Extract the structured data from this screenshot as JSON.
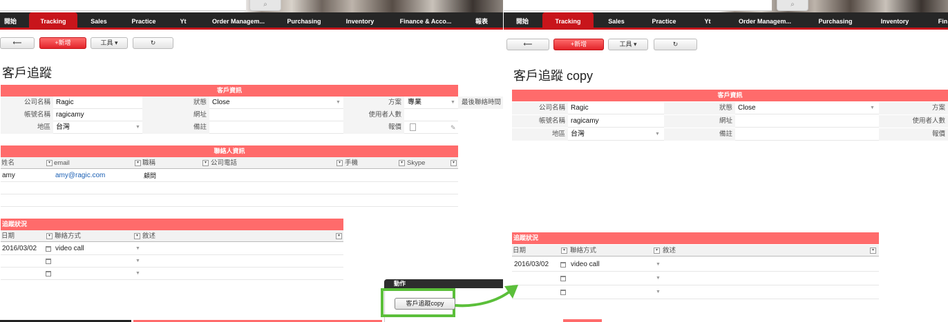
{
  "nav": {
    "left": [
      "開始",
      "Tracking",
      "Sales",
      "Practice",
      "Yt",
      "Order Managem...",
      "Purchasing",
      "Inventory",
      "Finance & Acco...",
      "報表"
    ],
    "right": [
      "開始",
      "Tracking",
      "Sales",
      "Practice",
      "Yt",
      "Order Managem...",
      "Purchasing",
      "Inventory",
      "Fin"
    ],
    "active": "Tracking"
  },
  "toolbar": {
    "back": "⟵",
    "new": "+新增",
    "tools": "工具 ▾",
    "refresh": "↻"
  },
  "icons": {
    "search": "search-icon",
    "back": "arrow-left-icon",
    "refresh": "refresh-icon",
    "calendar": "calendar-icon",
    "attach": "paperclip-icon",
    "file": "file-icon"
  },
  "colors": {
    "accent": "#ff6b6b",
    "nav_active": "#c8151b",
    "link": "#1a5fb4",
    "highlight": "#5bbf3a"
  },
  "left": {
    "title": "客戶追蹤",
    "customer_section": "客戶資訊",
    "fields": {
      "company_label": "公司名稱",
      "company": "Ragic",
      "status_label": "狀態",
      "status": "Close",
      "plan_label": "方案",
      "plan": "專業",
      "last_contact_label": "最後聯絡時間",
      "account_label": "帳號名稱",
      "account": "ragicamy",
      "website_label": "網址",
      "users_label": "使用者人數",
      "region_label": "地區",
      "region": "台灣",
      "note_label": "備註",
      "quote_label": "報價"
    },
    "contacts_section": "聯絡人資訊",
    "contacts_columns": [
      "姓名",
      "email",
      "職稱",
      "公司電話",
      "手機",
      "Skype"
    ],
    "contacts": [
      {
        "name": "amy",
        "email": "amy@ragic.com",
        "title": "顧問"
      }
    ],
    "tracking_section": "追蹤狀況",
    "tracking_columns": [
      "日期",
      "聯絡方式",
      "敘述"
    ],
    "tracking": [
      {
        "date": "2016/03/02",
        "method": "video call"
      }
    ],
    "action_title": "動作",
    "action_button": "客戶追蹤copy"
  },
  "right": {
    "title": "客戶追蹤 copy",
    "customer_section": "客戶資訊",
    "fields": {
      "company_label": "公司名稱",
      "company": "Ragic",
      "status_label": "狀態",
      "status": "Close",
      "plan_label": "方案",
      "account_label": "帳號名稱",
      "account": "ragicamy",
      "website_label": "網址",
      "users_label": "使用者人數",
      "region_label": "地區",
      "region": "台灣",
      "note_label": "備註",
      "quote_label": "報價"
    },
    "tracking_section": "追蹤狀況",
    "tracking_columns": [
      "日期",
      "聯絡方式",
      "敘述"
    ],
    "tracking": [
      {
        "date": "2016/03/02",
        "method": "video call"
      }
    ]
  }
}
